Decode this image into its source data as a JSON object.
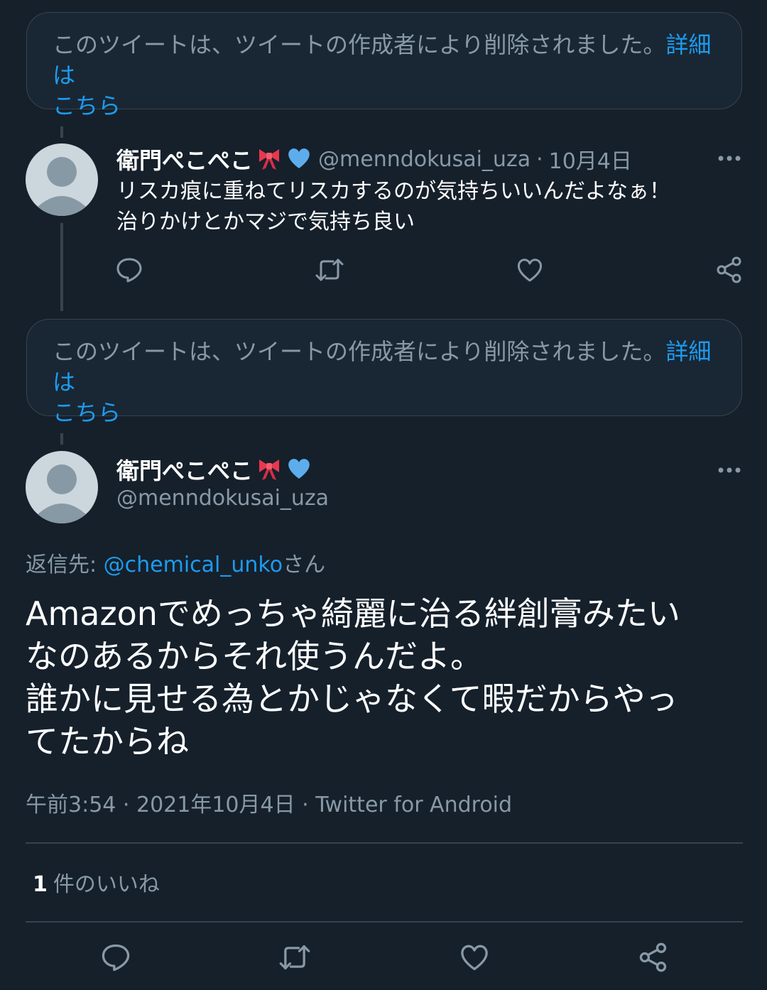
{
  "deleted_notice": {
    "text": "このツイートは、ツイートの作成者により削除されました。",
    "link_label": "詳細は",
    "link_label_cont": "こちら"
  },
  "tweet1": {
    "display_name": "衛門ぺこぺこ",
    "handle": "@menndokusai_uza",
    "separator": "·",
    "date": "10月4日",
    "text_line1": "リスカ痕に重ねてリスカするのが気持ちいいんだよなぁ！",
    "text_line2": "治りかけとかマジで気持ち良い"
  },
  "main_tweet": {
    "display_name": "衛門ぺこぺこ",
    "handle": "@menndokusai_uza",
    "reply_prefix": "返信先: ",
    "reply_mention": "@chemical_unko",
    "reply_suffix": "さん",
    "text_line1": "Amazonでめっちゃ綺麗に治る絆創膏みたい",
    "text_line2": "なのあるからそれ使うんだよ。",
    "text_line3": "誰かに見せる為とかじゃなくて暇だからやっ",
    "text_line4": "てたからね",
    "time": "午前3:54 · 2021年10月4日 · Twitter for Android",
    "likes_count": "1",
    "likes_label": "件のいいね"
  },
  "icons": {
    "more": "more-horizontal-icon",
    "reply": "reply-icon",
    "retweet": "retweet-icon",
    "like": "heart-icon",
    "share": "share-icon",
    "ribbon": "ribbon-emoji",
    "blue_heart": "blue-heart-emoji"
  },
  "colors": {
    "background": "#15202b",
    "accent": "#1d9bf0",
    "muted_text": "#8899a6",
    "border": "#38444d"
  }
}
